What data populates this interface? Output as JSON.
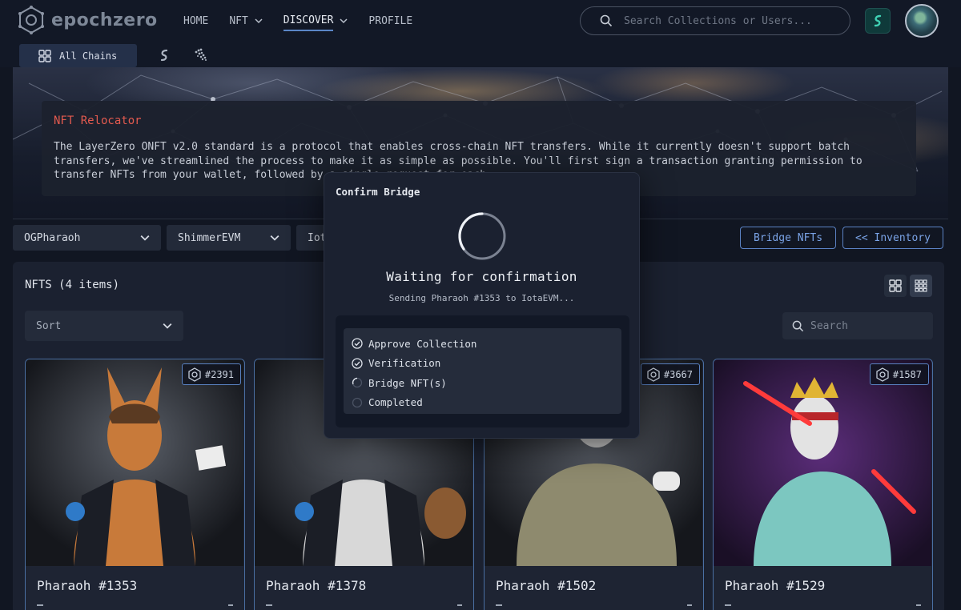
{
  "app": {
    "logo_text": "epochzero"
  },
  "nav": {
    "home": "HOME",
    "nft": "NFT",
    "discover": "DISCOVER",
    "profile": "PROFILE"
  },
  "search": {
    "placeholder": "Search Collections or Users..."
  },
  "chains": {
    "all_label": "All Chains"
  },
  "relocator": {
    "title": "NFT Relocator",
    "description": "The LayerZero ONFT v2.0 standard is a protocol that enables cross-chain NFT transfers. While it currently doesn't support batch transfers, we've streamlined the process to make it as simple as possible. You'll first sign a transaction granting permission to transfer NFTs from your wallet, followed by a single request for each"
  },
  "controls": {
    "collection": "OGPharaoh",
    "source_chain": "ShimmerEVM",
    "dest_chain": "Iot",
    "bridge_button": "Bridge NFTs",
    "inventory_button": "<< Inventory"
  },
  "nfts": {
    "title": "NFTS (4 items)",
    "sort_label": "Sort",
    "search_placeholder": "Search",
    "cards": [
      {
        "name": "Pharaoh #1353",
        "badge": "#2391"
      },
      {
        "name": "Pharaoh #1378",
        "badge": ""
      },
      {
        "name": "Pharaoh #1502",
        "badge": "#3667"
      },
      {
        "name": "Pharaoh #1529",
        "badge": "#1587"
      }
    ]
  },
  "modal": {
    "title": "Confirm Bridge",
    "status": "Waiting for confirmation",
    "detail": "Sending Pharaoh #1353 to IotaEVM...",
    "steps": [
      {
        "label": "Approve Collection",
        "state": "done"
      },
      {
        "label": "Verification",
        "state": "done"
      },
      {
        "label": "Bridge NFT(s)",
        "state": "loading"
      },
      {
        "label": "Completed",
        "state": "pending"
      }
    ]
  },
  "colors": {
    "accent": "#5b82c4",
    "relocator_title": "#e35a4f",
    "background": "#111622"
  }
}
